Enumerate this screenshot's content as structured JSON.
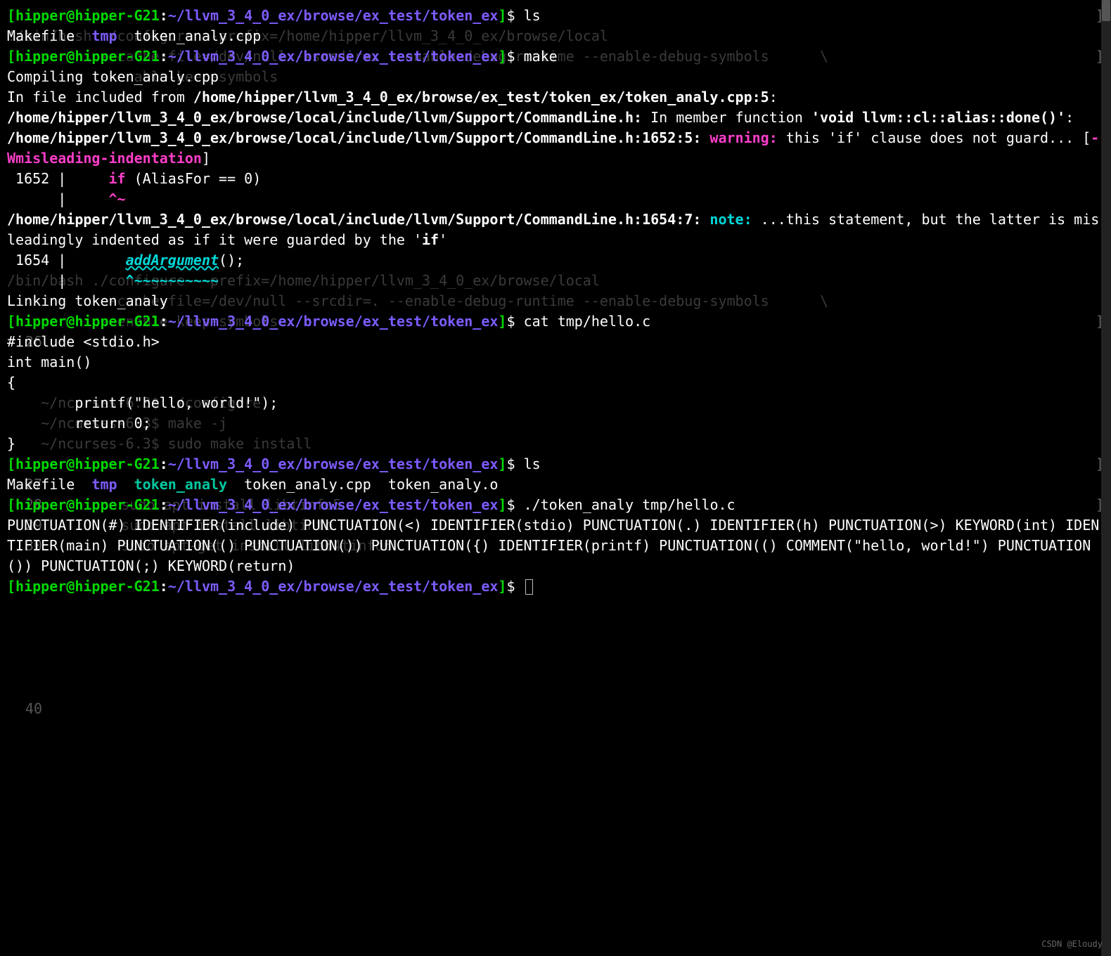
{
  "prompt": {
    "user": "hipper",
    "host": "hipper-G21",
    "path": "~/llvm_3_4_0_ex/browse/ex_test/token_ex",
    "symbol": "$"
  },
  "cmds": {
    "ls1": "ls",
    "make": "make",
    "cat": "cat tmp/hello.c",
    "ls2": "ls",
    "run": "./token_analy tmp/hello.c"
  },
  "ls1": {
    "f1": "Makefile",
    "d1": "tmp",
    "f2": "token_analy.cpp"
  },
  "make": {
    "compiling": "Compiling token_analy.cpp",
    "infile": "In file included from ",
    "infile_path": "/home/hipper/llvm_3_4_0_ex/browse/ex_test/token_ex/token_analy.cpp:5",
    "colon": ":",
    "path1": "/home/hipper/llvm_3_4_0_ex/browse/local/include/llvm/Support/CommandLine.h:",
    "inmember": " In member function ",
    "func": "'void llvm::cl::alias::done()'",
    "path2": "/home/hipper/llvm_3_4_0_ex/browse/local/include/llvm/Support/CommandLine.h:1652:5:",
    "warning_label": " warning:",
    "warning_msg": " this 'if' clause does not guard... [",
    "warning_flag": "-Wmisleading-indentation",
    "warning_close": "]",
    "line1652_num": " 1652 |     ",
    "line1652_if": "if",
    "line1652_rest": " (AliasFor == 0)",
    "line1652_caret_pre": "      |     ",
    "line1652_caret": "^~",
    "path3": "/home/hipper/llvm_3_4_0_ex/browse/local/include/llvm/Support/CommandLine.h:1654:7:",
    "note_label": " note:",
    "note_msg": " ...this statement, but the latter is misleadingly indented as if it were guarded by the '",
    "note_if": "if",
    "note_close": "'",
    "line1654_num": " 1654 |       ",
    "line1654_add": "addArgument",
    "line1654_rest": "();",
    "line1654_caret_pre": "      |       ",
    "line1654_caret": "^~~~~~~~~~~",
    "linking": "Linking token_analy"
  },
  "hello": {
    "l1": "#include <stdio.h>",
    "l2": "int main()",
    "l3": "{",
    "l4": "        printf(\"hello, world!\");",
    "l5": "        return 0;",
    "l6": "}"
  },
  "ls2": {
    "f1": "Makefile",
    "d1": "tmp",
    "e1": "token_analy",
    "f2": "token_analy.cpp",
    "f3": "token_analy.o"
  },
  "token_output": "PUNCTUATION(#) IDENTIFIER(include) PUNCTUATION(<) IDENTIFIER(stdio) PUNCTUATION(.) IDENTIFIER(h) PUNCTUATION(>) KEYWORD(int) IDENTIFIER(main) PUNCTUATION(() PUNCTUATION()) PUNCTUATION({) IDENTIFIER(printf) PUNCTUATION(() COMMENT(\"hello, world!\") PUNCTUATION()) PUNCTUATION(;) KEYWORD(return)",
  "ghost": {
    "l1": "!/bin/bash ./configure --prefix=/home/hipper/llvm_3_4_0_ex/browse/local",
    "l2": "           --cache-file=/dev/null --srcdir=. --enable-debug-runtime --enable-debug-symbols      \\",
    "l3": "           --enable-keep-symbols",
    "l13": "/bin/bash ./configure --prefix=/home/hipper/llvm_3_4_0_ex/browse/local",
    "l14": "           --cache-file=/dev/null --srcdir=. --enable-debug-runtime --enable-debug-symbols      \\",
    "l15": "           --enable-keep-symbols",
    "l19": "    ~/ncurses-6.3$ ./configure",
    "l20": "    ~/ncurses-6.3$ make -j",
    "l21": "    ~/ncurses-6.3$ sudo make install",
    "l24": "      sudo apt install libtinfo5",
    "l25": "      sudo apt install libtinfo",
    "l26": "      sudo apt-get install lib64tinfo6",
    "n16": "26",
    "n23": "27",
    "n24": "28",
    "n25": "29",
    "n26": "30",
    "n34": "40"
  },
  "watermark": "CSDN @Eloudy"
}
